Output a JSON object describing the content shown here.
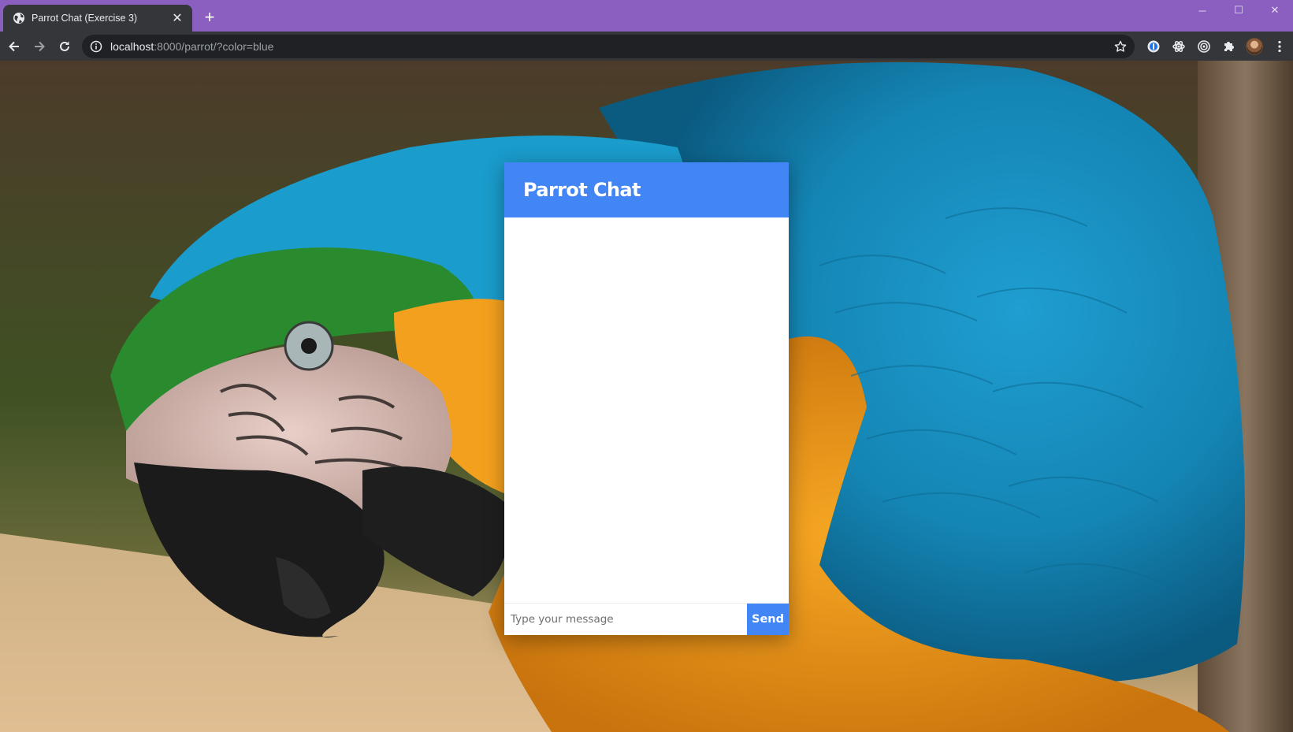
{
  "browser": {
    "tab_title": "Parrot Chat (Exercise 3)",
    "url_host": "localhost",
    "url_rest": ":8000/parrot/?color=blue",
    "tab_color": "#8a5fbf",
    "toolbar_color": "#35363a"
  },
  "window_controls": {
    "minimize": "─",
    "maximize": "☐",
    "close": "✕"
  },
  "icons": {
    "favicon": "globe-icon",
    "back": "arrow-left-icon",
    "forward": "arrow-right-icon",
    "reload": "reload-icon",
    "site_info": "info-icon",
    "bookmark": "star-icon",
    "extensions": [
      "onepassword-icon",
      "gear-flower-icon",
      "target-icon",
      "puzzle-icon"
    ],
    "menu": "vertical-dots-icon"
  },
  "chat": {
    "title": "Parrot Chat",
    "input_placeholder": "Type your message",
    "input_value": "",
    "send_label": "Send",
    "accent_color": "#4285f4"
  },
  "background": {
    "description_icon": "parrot-photo-image"
  }
}
